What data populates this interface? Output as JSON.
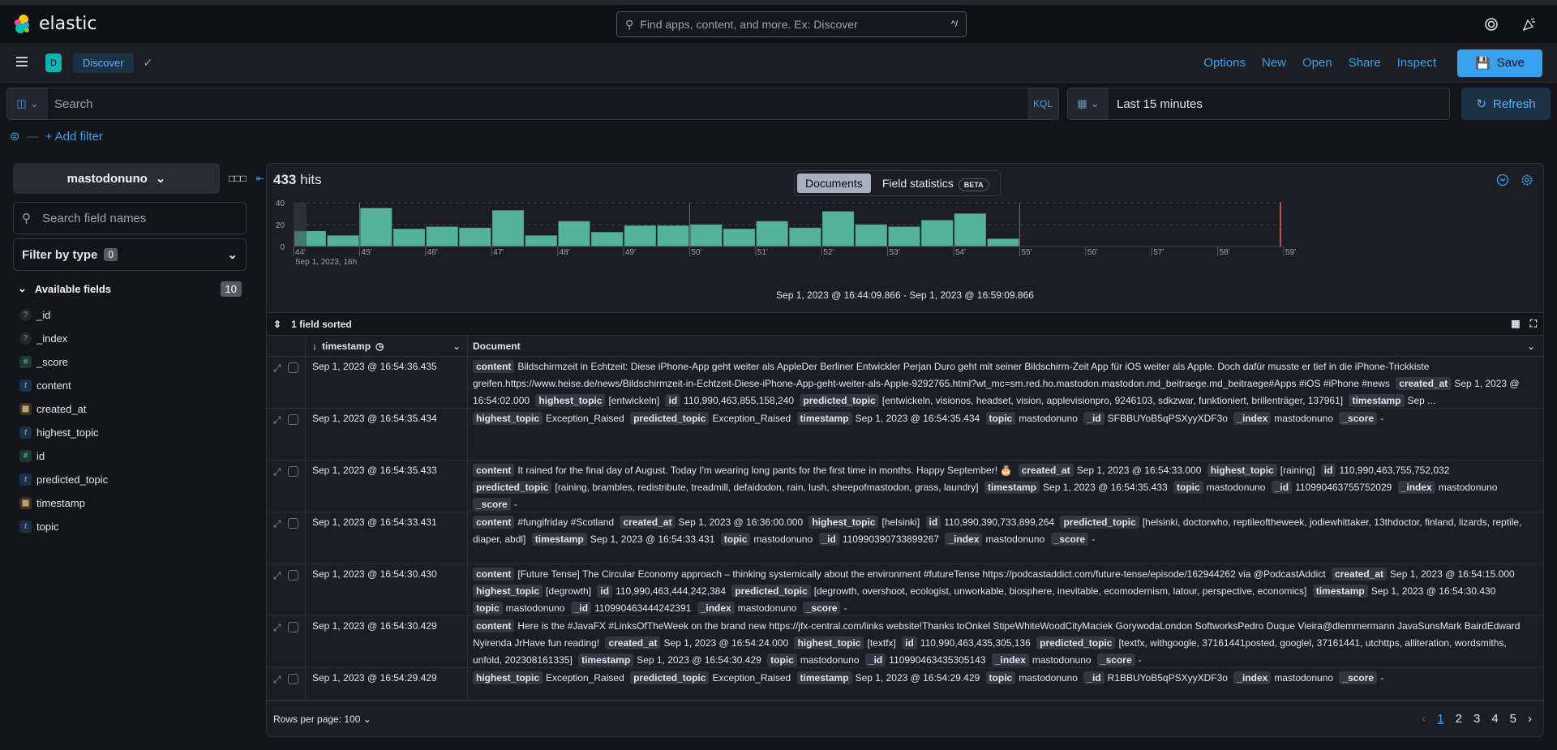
{
  "app": {
    "brand": "elastic",
    "global_search_placeholder": "Find apps, content, and more. Ex: Discover",
    "global_search_shortcut": "^/"
  },
  "nav": {
    "space_initial": "D",
    "breadcrumb": "Discover",
    "links": [
      "Options",
      "New",
      "Open",
      "Share",
      "Inspect"
    ],
    "save_label": "Save"
  },
  "query": {
    "placeholder": "Search",
    "language": "KQL",
    "time_range": "Last 15 minutes",
    "refresh_label": "Refresh",
    "add_filter": "+ Add filter"
  },
  "sidebar": {
    "data_view": "mastodonuno",
    "field_search_placeholder": "Search field names",
    "filter_by_type_label": "Filter by type",
    "filter_by_type_count": "0",
    "available_label": "Available fields",
    "available_count": "10",
    "fields": [
      {
        "name": "_id",
        "type": "unknown"
      },
      {
        "name": "_index",
        "type": "unknown"
      },
      {
        "name": "_score",
        "type": "number"
      },
      {
        "name": "content",
        "type": "text"
      },
      {
        "name": "created_at",
        "type": "date"
      },
      {
        "name": "highest_topic",
        "type": "text"
      },
      {
        "name": "id",
        "type": "number"
      },
      {
        "name": "predicted_topic",
        "type": "text"
      },
      {
        "name": "timestamp",
        "type": "date"
      },
      {
        "name": "topic",
        "type": "text"
      }
    ]
  },
  "main": {
    "hits_count": "433",
    "hits_label": "hits",
    "tabs": [
      "Documents",
      "Field statistics"
    ],
    "beta": "BETA",
    "time_range_text": "Sep 1, 2023 @ 16:44:09.866 - Sep 1, 2023 @ 16:59:09.866",
    "sorted_label": "1 field sorted",
    "columns": [
      "timestamp",
      "Document"
    ],
    "rows_per_page": "Rows per page: 100",
    "pages": [
      "1",
      "2",
      "3",
      "4",
      "5"
    ],
    "current_page": "1"
  },
  "chart_data": {
    "type": "bar",
    "title": "",
    "xlabel": "Sep 1, 2023, 16h",
    "ylabel": "",
    "ylim": [
      0,
      40
    ],
    "yticks": [
      0,
      20,
      40
    ],
    "x_tick_labels": [
      "44'",
      "45'",
      "46'",
      "47'",
      "48'",
      "49'",
      "50'",
      "51'",
      "52'",
      "53'",
      "54'",
      "55'",
      "56'",
      "57'",
      "58'",
      "59'"
    ],
    "bucket": "30s",
    "categories": [
      "16:44:00",
      "16:44:30",
      "16:45:00",
      "16:45:30",
      "16:46:00",
      "16:46:30",
      "16:47:00",
      "16:47:30",
      "16:48:00",
      "16:48:30",
      "16:49:00",
      "16:49:30",
      "16:50:00",
      "16:50:30",
      "16:51:00",
      "16:51:30",
      "16:52:00",
      "16:52:30",
      "16:53:00",
      "16:53:30",
      "16:54:00",
      "16:54:30"
    ],
    "values": [
      14,
      10,
      35,
      16,
      18,
      17,
      33,
      10,
      23,
      13,
      19,
      19,
      20,
      16,
      23,
      17,
      32,
      20,
      18,
      24,
      30,
      7
    ],
    "color": "#54b399",
    "grid": true
  },
  "rows": [
    {
      "ts": "Sep 1, 2023 @ 16:54:36.435",
      "fields": [
        [
          "content",
          "Bildschirmzeit in Echtzeit: Diese iPhone-App geht weiter als AppleDer Berliner Entwickler Perjan Duro geht mit seiner Bildschirm-Zeit App für iOS weiter als Apple. Doch dafür musste er tief in die iPhone-Trickkiste greifen.https://www.heise.de/news/Bildschirmzeit-in-Echtzeit-Diese-iPhone-App-geht-weiter-als-Apple-9292765.html?wt_mc=sm.red.ho.mastodon.mastodon.md_beitraege.md_beitraege#Apps #iOS #iPhone #news"
        ],
        [
          "created_at",
          "Sep 1, 2023 @ 16:54:02.000"
        ],
        [
          "highest_topic",
          "[entwickeln]"
        ],
        [
          "id",
          "110,990,463,855,158,240"
        ],
        [
          "predicted_topic",
          "[entwickeln, visionos, headset, vision, applevisionpro, 9246103, sdkzwar, funktioniert, brillenträger, 137961]"
        ],
        [
          "timestamp",
          "Sep ..."
        ]
      ]
    },
    {
      "ts": "Sep 1, 2023 @ 16:54:35.434",
      "fields": [
        [
          "highest_topic",
          "Exception_Raised"
        ],
        [
          "predicted_topic",
          "Exception_Raised"
        ],
        [
          "timestamp",
          "Sep 1, 2023 @ 16:54:35.434"
        ],
        [
          "topic",
          "mastodonuno"
        ],
        [
          "_id",
          "SFBBUYoB5qPSXyyXDF3o"
        ],
        [
          "_index",
          "mastodonuno"
        ],
        [
          "_score",
          "-"
        ]
      ]
    },
    {
      "ts": "Sep 1, 2023 @ 16:54:35.433",
      "fields": [
        [
          "content",
          "It rained for the final day of August. Today I'm wearing long pants for the first time in months. Happy September! 🎂"
        ],
        [
          "created_at",
          "Sep 1, 2023 @ 16:54:33.000"
        ],
        [
          "highest_topic",
          "[raining]"
        ],
        [
          "id",
          "110,990,463,755,752,032"
        ],
        [
          "predicted_topic",
          "[raining, brambles, redistribute, treadmill, defaidodon, rain, lush, sheepofmastodon, grass, laundry]"
        ],
        [
          "timestamp",
          "Sep 1, 2023 @ 16:54:35.433"
        ],
        [
          "topic",
          "mastodonuno"
        ],
        [
          "_id",
          "110990463755752029"
        ],
        [
          "_index",
          "mastodonuno"
        ],
        [
          "_score",
          "-"
        ]
      ]
    },
    {
      "ts": "Sep 1, 2023 @ 16:54:33.431",
      "fields": [
        [
          "content",
          "#fungifriday #Scotland"
        ],
        [
          "created_at",
          "Sep 1, 2023 @ 16:36:00.000"
        ],
        [
          "highest_topic",
          "[helsinki]"
        ],
        [
          "id",
          "110,990,390,733,899,264"
        ],
        [
          "predicted_topic",
          "[helsinki, doctorwho, reptileoftheweek, jodiewhittaker, 13thdoctor, finland, lizards, reptile, diaper, abdl]"
        ],
        [
          "timestamp",
          "Sep 1, 2023 @ 16:54:33.431"
        ],
        [
          "topic",
          "mastodonuno"
        ],
        [
          "_id",
          "110990390733899267"
        ],
        [
          "_index",
          "mastodonuno"
        ],
        [
          "_score",
          "-"
        ]
      ]
    },
    {
      "ts": "Sep 1, 2023 @ 16:54:30.430",
      "fields": [
        [
          "content",
          "[Future Tense] The Circular Economy approach – thinking systemically about the environment #futureTense https://podcastaddict.com/future-tense/episode/162944262 via @PodcastAddict"
        ],
        [
          "created_at",
          "Sep 1, 2023 @ 16:54:15.000"
        ],
        [
          "highest_topic",
          "[degrowth]"
        ],
        [
          "id",
          "110,990,463,444,242,384"
        ],
        [
          "predicted_topic",
          "[degrowth, overshoot, ecologist, unworkable, biosphere, inevitable, ecomodernism, latour, perspective, economics]"
        ],
        [
          "timestamp",
          "Sep 1, 2023 @ 16:54:30.430"
        ],
        [
          "topic",
          "mastodonuno"
        ],
        [
          "_id",
          "110990463444242391"
        ],
        [
          "_index",
          "mastodonuno"
        ],
        [
          "_score",
          "-"
        ]
      ]
    },
    {
      "ts": "Sep 1, 2023 @ 16:54:30.429",
      "fields": [
        [
          "content",
          "Here is the #JavaFX #LinksOfTheWeek on the brand new https://jfx-central.com/links website!Thanks toOnkel StipeWhiteWoodCityMaciek GorywodaLondon SoftworksPedro Duque Vieira@dlemmermann JavaSunsMark BairdEdward Nyirenda JrHave fun reading!"
        ],
        [
          "created_at",
          "Sep 1, 2023 @ 16:54:24.000"
        ],
        [
          "highest_topic",
          "[textfx]"
        ],
        [
          "id",
          "110,990,463,435,305,136"
        ],
        [
          "predicted_topic",
          "[textfx, withgoogle, 37161441posted, googlel, 37161441, utchttps, alliteration, wordsmiths, unfold, 202308161335]"
        ],
        [
          "timestamp",
          "Sep 1, 2023 @ 16:54:30.429"
        ],
        [
          "topic",
          "mastodonuno"
        ],
        [
          "_id",
          "110990463435305143"
        ],
        [
          "_index",
          "mastodonuno"
        ],
        [
          "_score",
          "-"
        ]
      ]
    },
    {
      "ts": "Sep 1, 2023 @ 16:54:29.429",
      "fields": [
        [
          "highest_topic",
          "Exception_Raised"
        ],
        [
          "predicted_topic",
          "Exception_Raised"
        ],
        [
          "timestamp",
          "Sep 1, 2023 @ 16:54:29.429"
        ],
        [
          "topic",
          "mastodonuno"
        ],
        [
          "_id",
          "R1BBUYoB5qPSXyyXDF3o"
        ],
        [
          "_index",
          "mastodonuno"
        ],
        [
          "_score",
          "-"
        ]
      ]
    }
  ]
}
